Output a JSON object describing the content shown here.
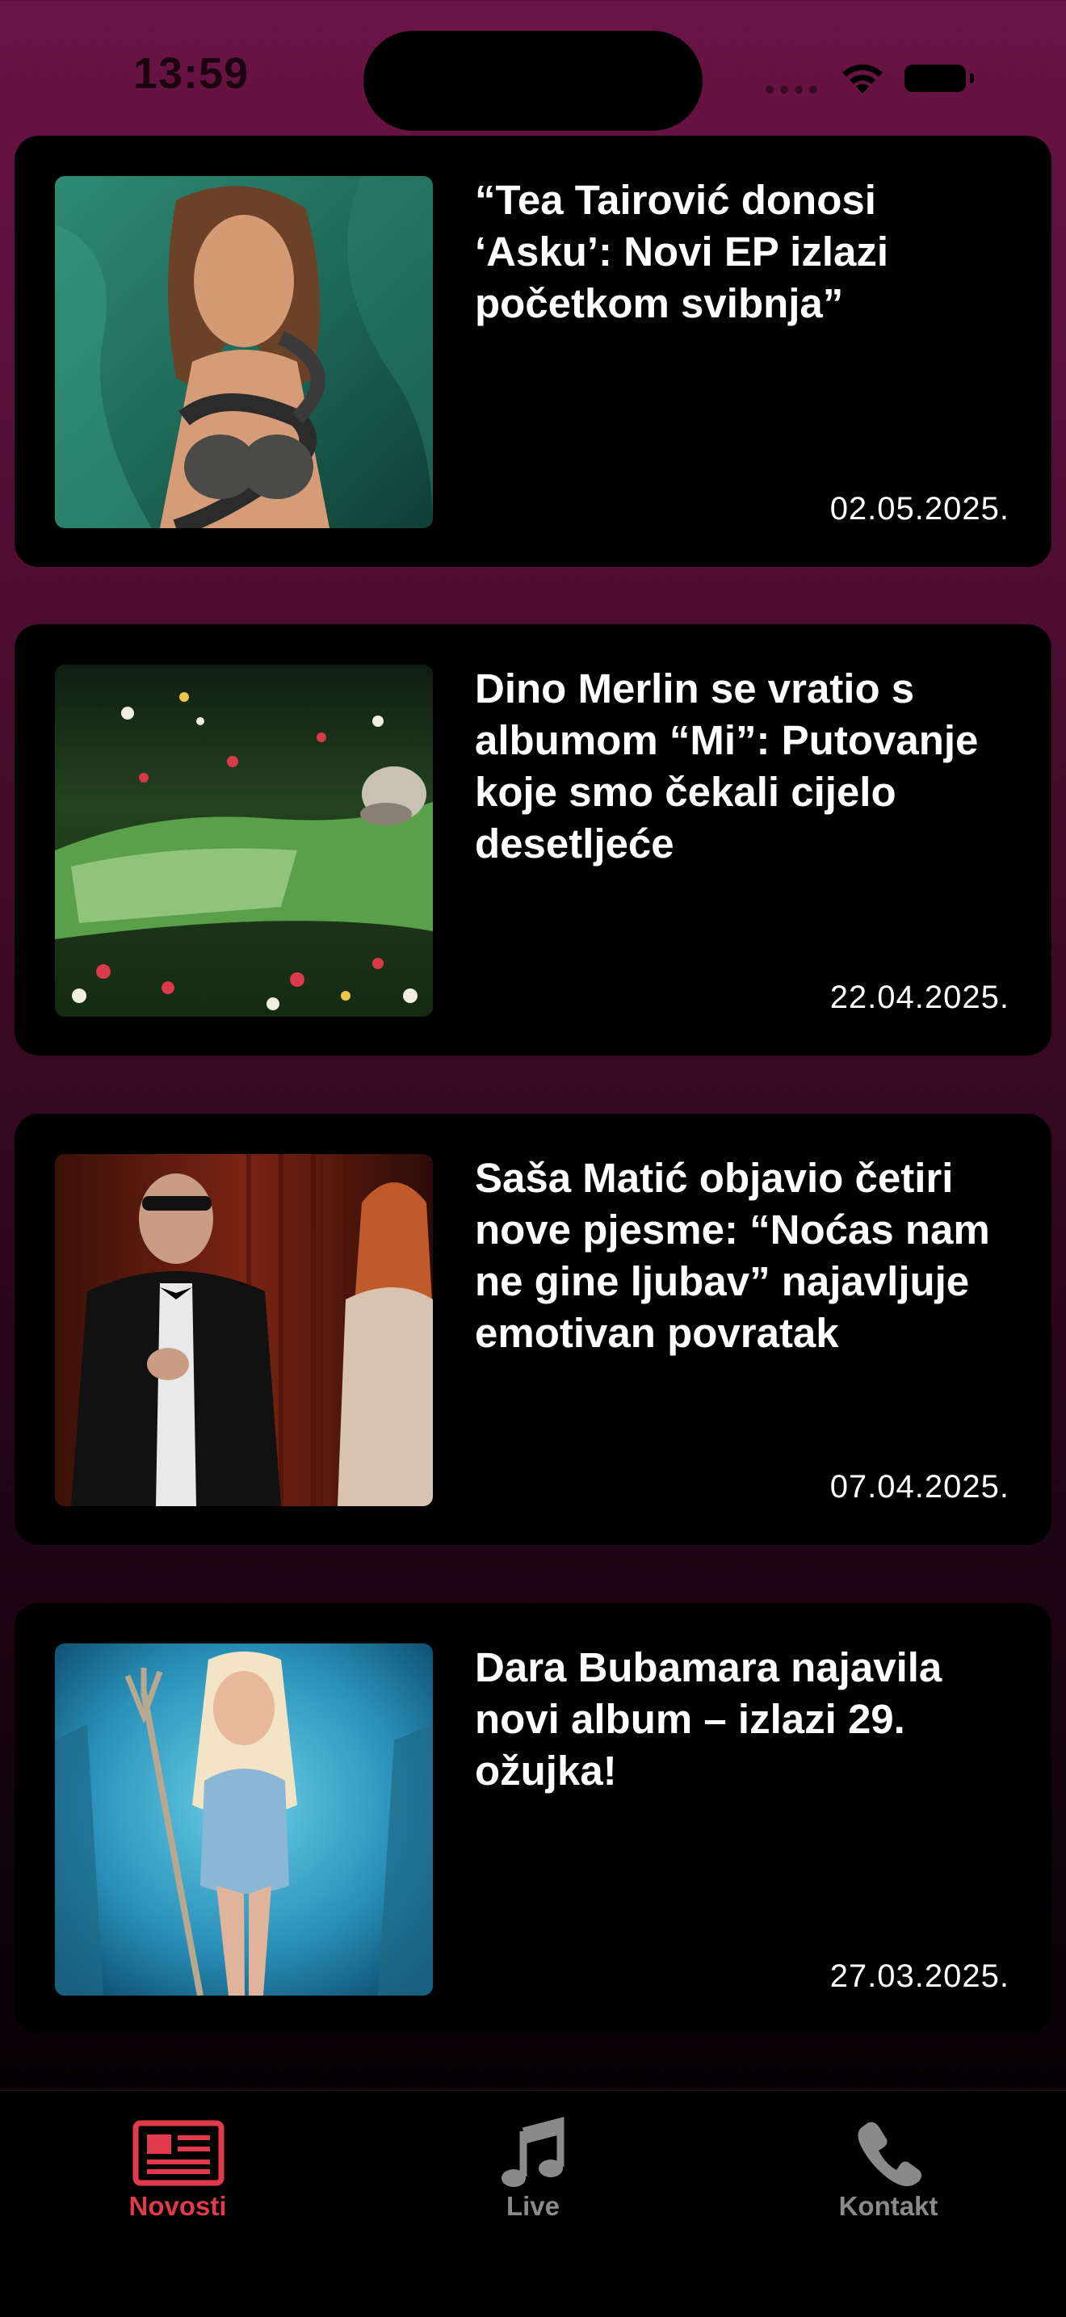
{
  "status_bar": {
    "time": "13:59"
  },
  "articles": [
    {
      "title": "“Tea Tairović donosi ‘Asku’: Novi EP izlazi početkom svibnja”",
      "date": "02.05.2025.",
      "image": "photo-woman-green-satin-snake"
    },
    {
      "title": "Dino Merlin se vratio s albumom “Mi”: Putovanje koje smo čekali cijelo desetljeće",
      "date": "22.04.2025.",
      "image": "photo-man-lying-in-flowers"
    },
    {
      "title": "Saša Matić objavio četiri nove pjesme: “Noćas nam ne gine ljubav” najavljuje emotivan povratak",
      "date": "07.04.2025.",
      "image": "photo-man-tuxedo-red-curtain"
    },
    {
      "title": "Dara Bubamara najavila novi album – izlazi 29. ožujka!",
      "date": "27.03.2025.",
      "image": "photo-woman-trident-underwater"
    }
  ],
  "tabbar": {
    "active_color": "#e03a4c",
    "inactive_color": "#8a8a8a",
    "tabs": [
      {
        "label": "Novosti",
        "icon": "newspaper-icon",
        "active": true
      },
      {
        "label": "Live",
        "icon": "music-note-icon",
        "active": false
      },
      {
        "label": "Kontakt",
        "icon": "phone-icon",
        "active": false
      }
    ]
  }
}
